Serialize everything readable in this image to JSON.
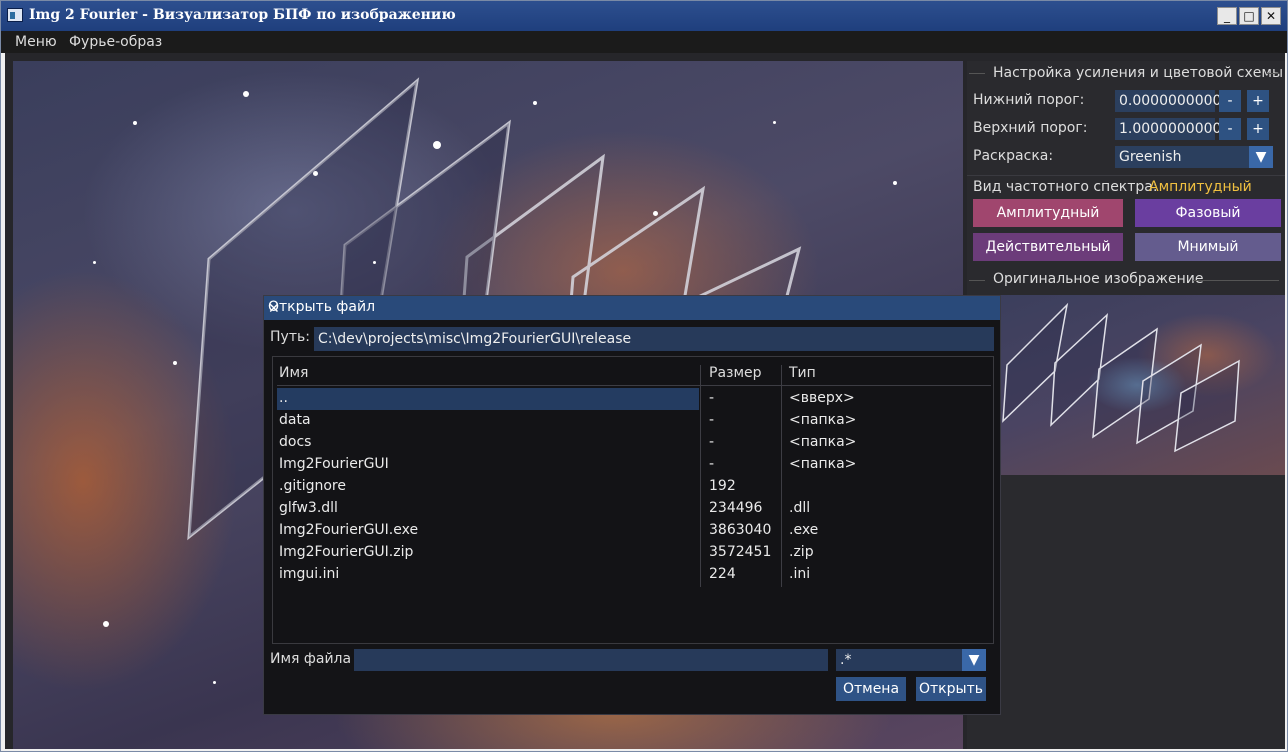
{
  "window": {
    "title": "Img 2 Fourier - Визуализатор БПФ по изображению",
    "minimize": "_",
    "maximize": "□",
    "close": "✕"
  },
  "menu": {
    "items": [
      "Меню",
      "Фурье-образ"
    ]
  },
  "panel": {
    "gain_header": "Настройка усиления и цветовой схемы",
    "lower_label": "Нижний порог:",
    "lower_value": "0.0000000000",
    "upper_label": "Верхний порог:",
    "upper_value": "1.0000000000",
    "minus": "-",
    "plus": "+",
    "color_label": "Раскраска:",
    "color_value": "Greenish",
    "spectrum_label": "Вид частотного спектра:",
    "spectrum_value": "Амплитудный",
    "buttons": {
      "amplitude": "Амплитудный",
      "phase": "Фазовый",
      "real": "Действительный",
      "imaginary": "Мнимый"
    },
    "original_header": "Оригинальное изображение"
  },
  "dialog": {
    "title": "Открыть файл",
    "close": "✕",
    "path_label": "Путь:",
    "path_value": "C:\\dev\\projects\\misc\\Img2FourierGUI\\release",
    "columns": [
      "Имя",
      "Размер",
      "Тип"
    ],
    "files": [
      {
        "name": "..",
        "size": "-",
        "type": "<вверх>"
      },
      {
        "name": "data",
        "size": "-",
        "type": "<папка>"
      },
      {
        "name": "docs",
        "size": "-",
        "type": "<папка>"
      },
      {
        "name": "Img2FourierGUI",
        "size": "-",
        "type": "<папка>"
      },
      {
        "name": ".gitignore",
        "size": "192",
        "type": ""
      },
      {
        "name": "glfw3.dll",
        "size": "234496",
        "type": ".dll"
      },
      {
        "name": "Img2FourierGUI.exe",
        "size": "3863040",
        "type": ".exe"
      },
      {
        "name": "Img2FourierGUI.zip",
        "size": "3572451",
        "type": ".zip"
      },
      {
        "name": "imgui.ini",
        "size": "224",
        "type": ".ini"
      }
    ],
    "filename_label": "Имя файла",
    "filename_value": "",
    "filter_value": ".*",
    "cancel": "Отмена",
    "open": "Открыть"
  },
  "colors": {
    "accent": "#2e5282",
    "amplitude_btn": "#a0466e",
    "phase_btn": "#6a3ea0",
    "real_btn": "#6c3c7a",
    "imaginary_btn": "#645c8e",
    "spectrum_value": "#f0c040"
  }
}
